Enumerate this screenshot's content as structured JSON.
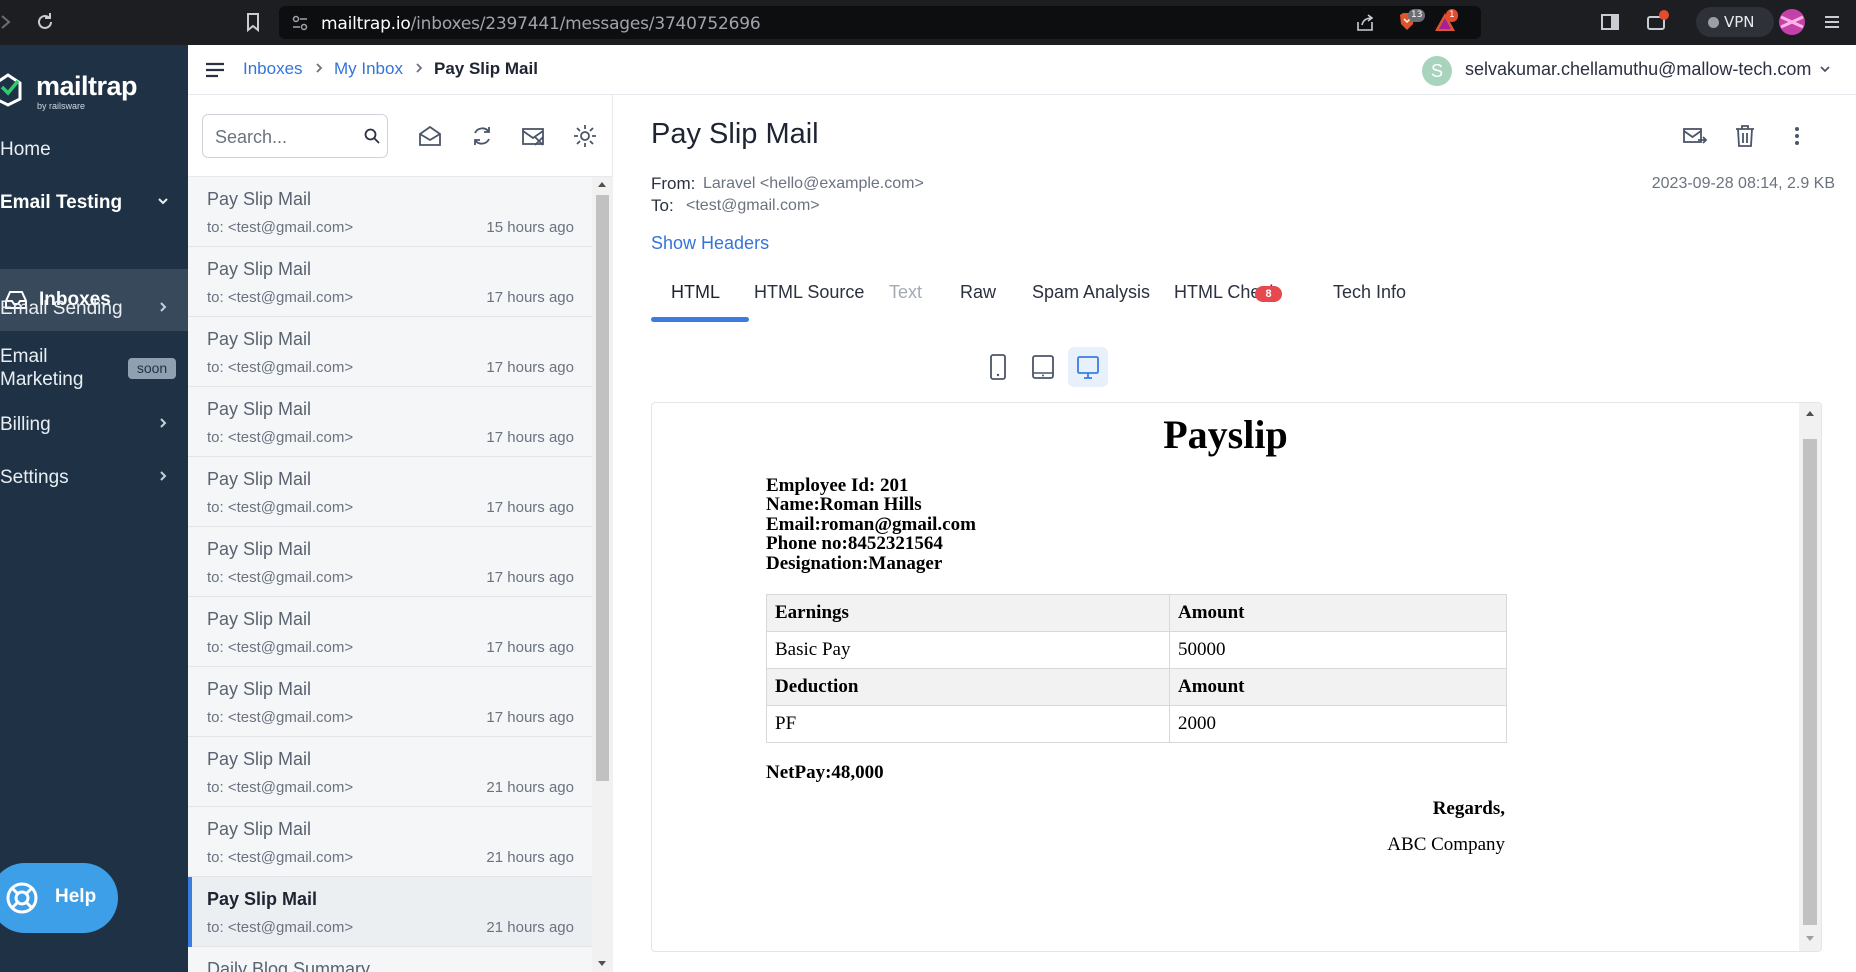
{
  "browser": {
    "url_host": "mailtrap.io",
    "url_path": "/inboxes/2397441/messages/3740752696",
    "brave_count": "13",
    "alert_count": "1",
    "vpn_label": "VPN"
  },
  "sidebar": {
    "logo": "mailtrap",
    "logo_sub": "by railsware",
    "items": [
      {
        "label": "Home"
      },
      {
        "label": "Email Testing"
      },
      {
        "label": "Inboxes"
      },
      {
        "label": "Email Sending"
      },
      {
        "label": "Email"
      },
      {
        "label": "Marketing"
      },
      {
        "label": "Billing"
      },
      {
        "label": "Settings"
      }
    ],
    "soon_badge": "soon",
    "help_label": "Help"
  },
  "topbar": {
    "crumbs": [
      "Inboxes",
      "My Inbox",
      "Pay Slip Mail"
    ],
    "avatar_letter": "S",
    "user_email": "selvakumar.chellamuthu@mallow-tech.com"
  },
  "list": {
    "search_placeholder": "Search...",
    "messages": [
      {
        "subject": "Pay Slip Mail",
        "to": "to: <test@gmail.com>",
        "time": "15 hours ago"
      },
      {
        "subject": "Pay Slip Mail",
        "to": "to: <test@gmail.com>",
        "time": "17 hours ago"
      },
      {
        "subject": "Pay Slip Mail",
        "to": "to: <test@gmail.com>",
        "time": "17 hours ago"
      },
      {
        "subject": "Pay Slip Mail",
        "to": "to: <test@gmail.com>",
        "time": "17 hours ago"
      },
      {
        "subject": "Pay Slip Mail",
        "to": "to: <test@gmail.com>",
        "time": "17 hours ago"
      },
      {
        "subject": "Pay Slip Mail",
        "to": "to: <test@gmail.com>",
        "time": "17 hours ago"
      },
      {
        "subject": "Pay Slip Mail",
        "to": "to: <test@gmail.com>",
        "time": "17 hours ago"
      },
      {
        "subject": "Pay Slip Mail",
        "to": "to: <test@gmail.com>",
        "time": "17 hours ago"
      },
      {
        "subject": "Pay Slip Mail",
        "to": "to: <test@gmail.com>",
        "time": "21 hours ago"
      },
      {
        "subject": "Pay Slip Mail",
        "to": "to: <test@gmail.com>",
        "time": "21 hours ago"
      },
      {
        "subject": "Pay Slip Mail",
        "to": "to: <test@gmail.com>",
        "time": "21 hours ago"
      },
      {
        "subject": "Daily Blog Summary",
        "to": "",
        "time": ""
      }
    ]
  },
  "message": {
    "title": "Pay Slip Mail",
    "from_label": "From:",
    "from_value": "Laravel <hello@example.com>",
    "to_label": "To:",
    "to_value": "<test@gmail.com>",
    "meta": "2023-09-28 08:14, 2.9 KB",
    "show_headers": "Show Headers",
    "tabs": [
      "HTML",
      "HTML Source",
      "Text",
      "Raw",
      "Spam Analysis",
      "HTML Check",
      "Tech Info"
    ],
    "html_check_badge": "8"
  },
  "payslip": {
    "title": "Payslip",
    "lines": [
      "Employee Id: 201",
      "Name:Roman Hills",
      "Email:roman@gmail.com",
      "Phone no:8452321564",
      "Designation:Manager"
    ],
    "table": {
      "earnings_header": "Earnings",
      "amount_header": "Amount",
      "basic_pay_label": "Basic Pay",
      "basic_pay_value": "50000",
      "deduction_header": "Deduction",
      "amount_header_2": "Amount",
      "pf_label": "PF",
      "pf_value": "2000"
    },
    "netpay": "NetPay:48,000",
    "regards": "Regards,",
    "company": "ABC Company"
  },
  "colors": {
    "sidebar_bg": "#1f3245",
    "accent": "#3a7de0",
    "help": "#3d9fe8",
    "badge_red": "#e5484d"
  }
}
